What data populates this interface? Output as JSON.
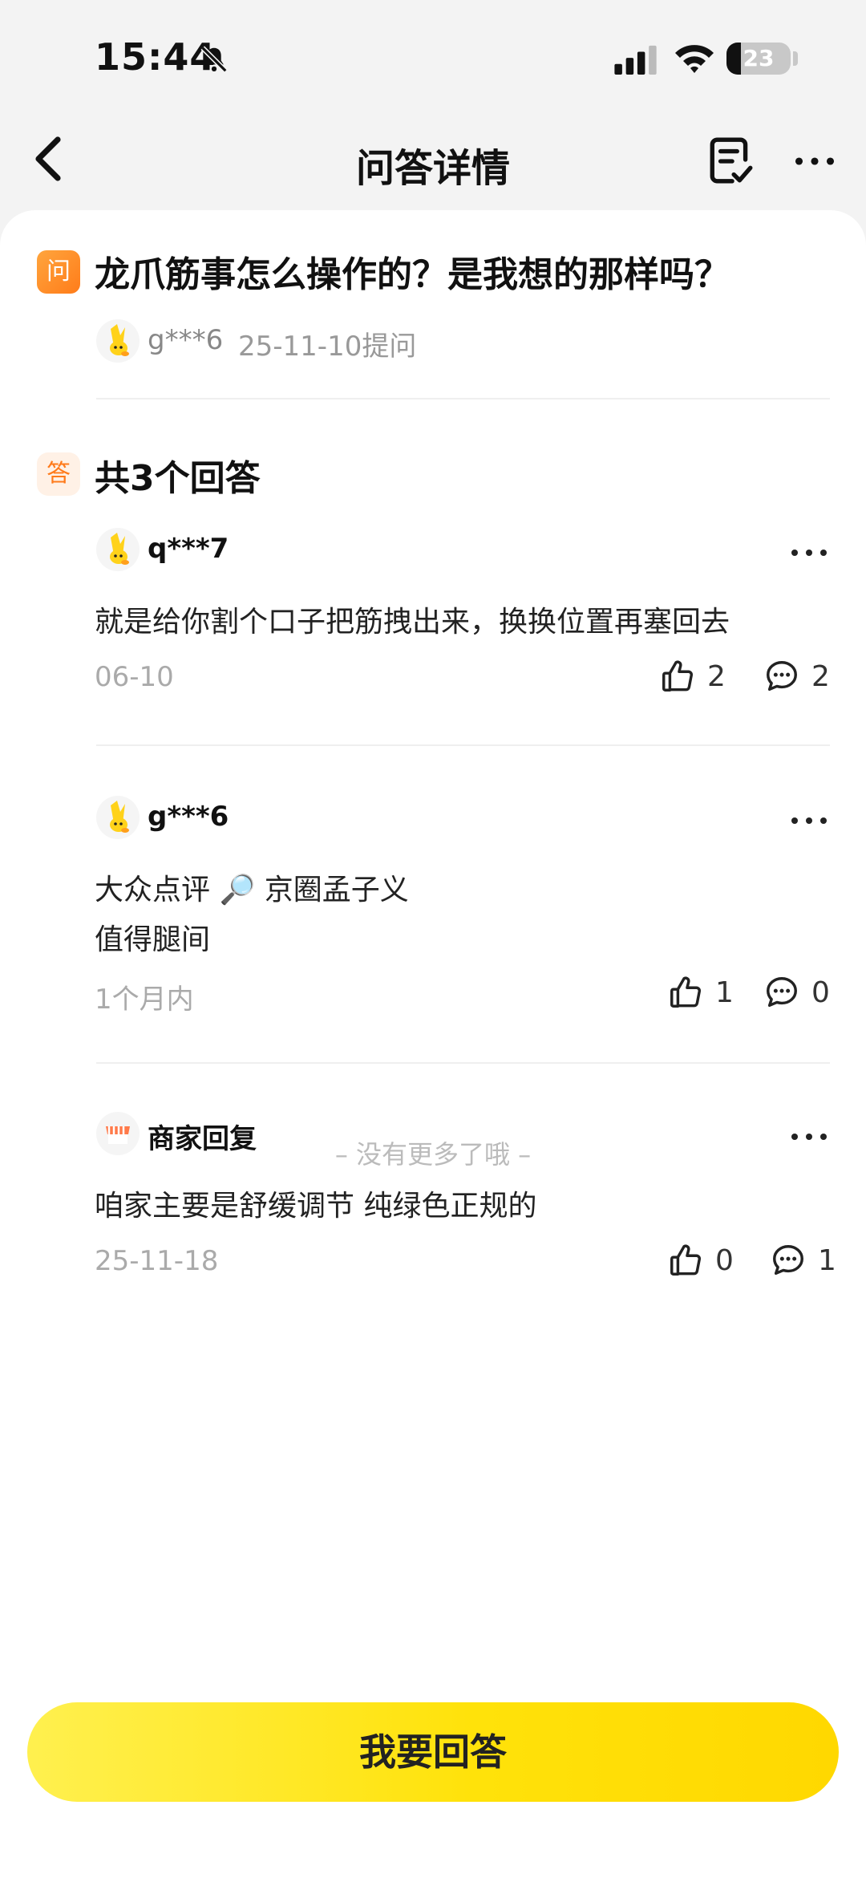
{
  "status_bar": {
    "time": "15:44",
    "battery": "23",
    "battery_level": 0.23
  },
  "nav": {
    "title": "问答详情"
  },
  "question": {
    "badge": "问",
    "title": "龙爪筋事怎么操作的？是我想的那样吗？",
    "asker": "g***6",
    "date": "25-11-10提问"
  },
  "answers_header": {
    "badge": "答",
    "count_label": "共3个回答"
  },
  "answers": [
    {
      "user": "q***7",
      "lines": [
        "就是给你割个口子把筋拽出来，换换位置再塞回去"
      ],
      "date": "06-10",
      "likes": "2",
      "comments": "2"
    },
    {
      "user": "g***6",
      "lines": [
        "大众点评 🔎 京圈孟子义",
        "值得腿间"
      ],
      "date": "1个月内",
      "likes": "1",
      "comments": "0"
    },
    {
      "user": "商家回复",
      "lines": [
        "咱家主要是舒缓调节 纯绿色正规的"
      ],
      "date": "25-11-18",
      "likes": "0",
      "comments": "1"
    }
  ],
  "footer": {
    "no_more": "– 没有更多了哦 –",
    "answer_button": "我要回答"
  },
  "colors": {
    "accent_yellow": "#FFE20A",
    "question_orange": "#FF8A1F",
    "answer_badge_bg": "#FFF1E6"
  }
}
